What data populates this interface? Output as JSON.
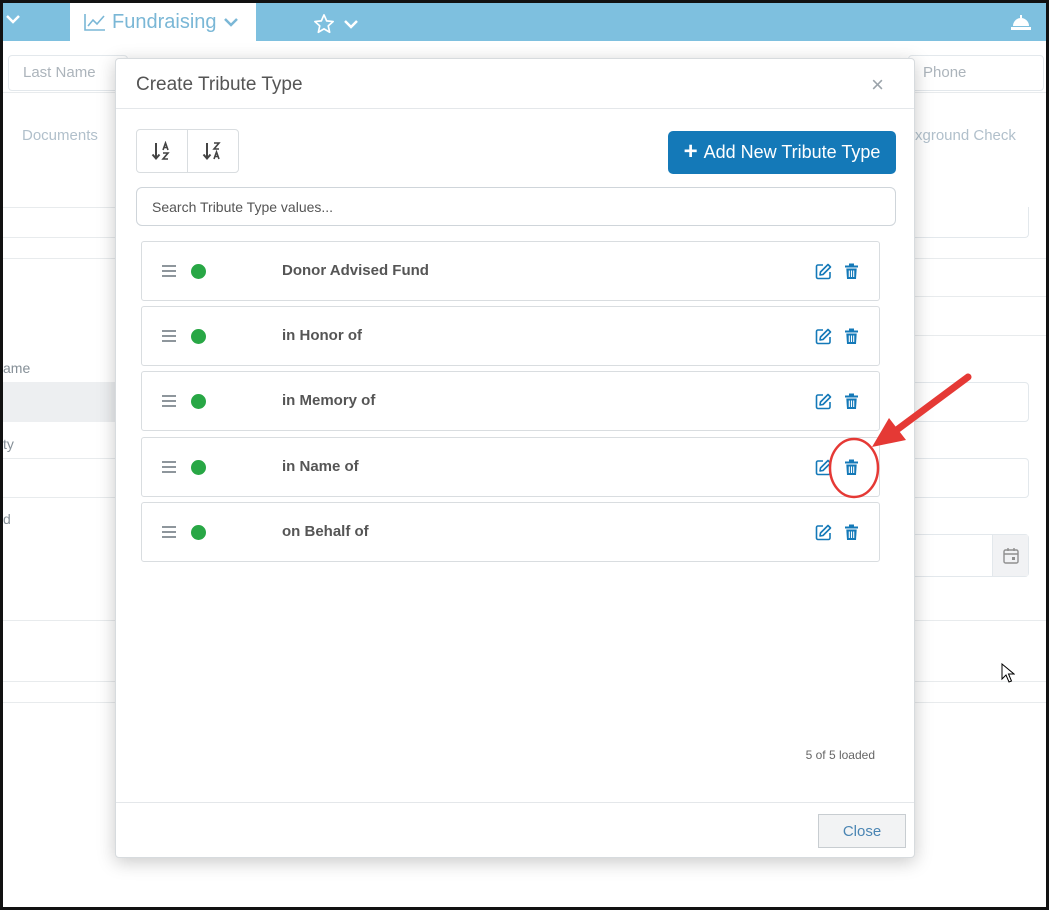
{
  "topbar": {
    "active_tab_label": "Fundraising"
  },
  "background": {
    "last_name_placeholder": "Last Name",
    "phone_placeholder": "Phone",
    "documents_tab": "Documents",
    "background_check_tab": "xground Check",
    "label_name": "ame",
    "label_city": "ty",
    "label_d": "d"
  },
  "modal": {
    "title": "Create Tribute Type",
    "close_glyph": "×",
    "add_button_label": "Add New Tribute Type",
    "search_placeholder": "Search Tribute Type values...",
    "items": [
      {
        "label": "Donor Advised Fund",
        "status": "active"
      },
      {
        "label": "in Honor of",
        "status": "active"
      },
      {
        "label": "in Memory of",
        "status": "active"
      },
      {
        "label": "in Name of",
        "status": "active"
      },
      {
        "label": "on Behalf of",
        "status": "active"
      }
    ],
    "loaded_text": "5 of 5 loaded",
    "close_button_label": "Close"
  },
  "colors": {
    "topbar": "#7ec0df",
    "primary_button": "#1479b8",
    "status_active": "#28a745",
    "icon_blue": "#1479b8",
    "annotation_red": "#e53935"
  },
  "icons": {
    "sort_ascending": "sort-a-z-icon",
    "sort_descending": "sort-z-a-icon",
    "drag_handle": "drag-handle-icon",
    "edit": "edit-icon",
    "delete": "trash-icon"
  }
}
